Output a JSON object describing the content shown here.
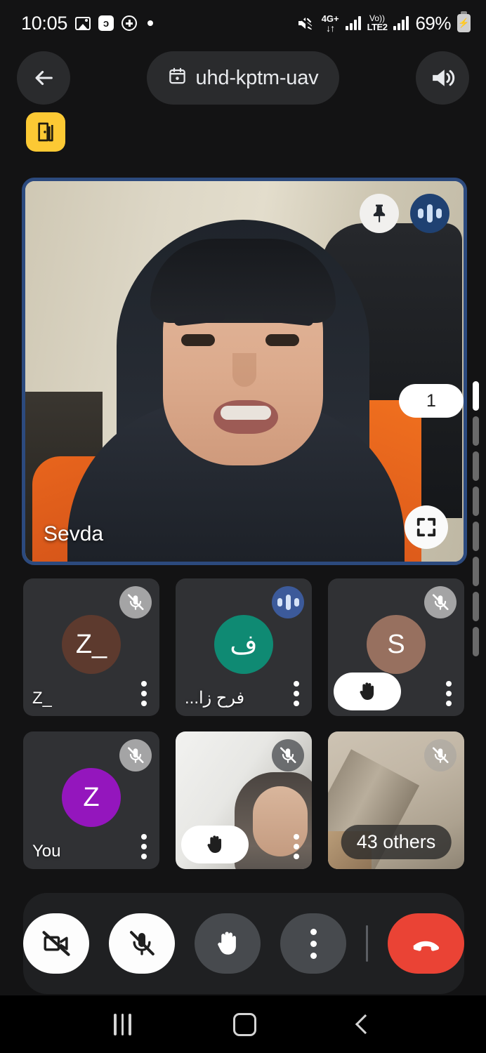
{
  "status_bar": {
    "time": "10:05",
    "icons_left": [
      "photo-icon",
      "youtube-music-icon",
      "plus-circle-icon",
      "dot-icon"
    ],
    "music_badge_glyph": "ᴐ",
    "speaker_mute_icon": "speaker-mute-icon",
    "network_type": "4G+",
    "network_arrows": "↓↑",
    "volte_top": "Vo))",
    "volte_bottom": "LTE2",
    "battery_percent": "69%",
    "battery_glyph": "⚡"
  },
  "top_bar": {
    "back_label": "←",
    "calendar_icon": "calendar-icon",
    "meeting_code": "uhd-kptm-uav",
    "speaker_icon": "volume-up-icon"
  },
  "door_badge": {
    "icon": "door-exit-icon",
    "color": "#fcc934"
  },
  "main_tile": {
    "name": "Sevda",
    "pin_icon": "pin-icon",
    "speaking_icon": "audio-levels-icon",
    "fullscreen_icon": "fullscreen-icon",
    "border_color": "#2c4a7e"
  },
  "pagination": {
    "current_page": "1",
    "total_ticks": 8,
    "active_index": 0
  },
  "participants": [
    {
      "name": "Z_",
      "initial": "Z_",
      "avatar_color": "#5d3a2e",
      "type": "avatar",
      "muted": true,
      "speaking": false,
      "hand_raised": false,
      "menu_icon": "more-vertical-icon"
    },
    {
      "name": "فرح زا...",
      "initial": "ف",
      "avatar_color": "#0f8a73",
      "type": "avatar",
      "muted": false,
      "speaking": true,
      "hand_raised": false,
      "menu_icon": "more-vertical-icon"
    },
    {
      "name": "S",
      "initial": "S",
      "avatar_color": "#97705f",
      "type": "avatar",
      "muted": true,
      "speaking": false,
      "hand_raised": true,
      "menu_icon": "more-vertical-icon"
    },
    {
      "name": "You",
      "initial": "Z",
      "avatar_color": "#9416bd",
      "type": "avatar",
      "muted": true,
      "speaking": false,
      "hand_raised": false,
      "menu_icon": "more-vertical-icon"
    },
    {
      "name": "",
      "initial": "",
      "avatar_color": "",
      "type": "video-person",
      "muted": true,
      "speaking": false,
      "hand_raised": true,
      "menu_icon": "more-vertical-icon"
    },
    {
      "name": "",
      "initial": "",
      "avatar_color": "",
      "type": "video-room",
      "muted": true,
      "speaking": false,
      "hand_raised": false,
      "overlay_label": "43 others",
      "menu_icon": "more-vertical-icon"
    }
  ],
  "toolbar": {
    "camera_off_icon": "video-off-icon",
    "mic_off_icon": "mic-off-icon",
    "raise_hand_icon": "raise-hand-icon",
    "more_icon": "more-vertical-icon",
    "end_call_icon": "end-call-icon",
    "end_call_color": "#ea4335"
  },
  "nav_bar": {
    "recents_icon": "recents-icon",
    "home_icon": "home-icon",
    "back_icon": "back-icon"
  }
}
